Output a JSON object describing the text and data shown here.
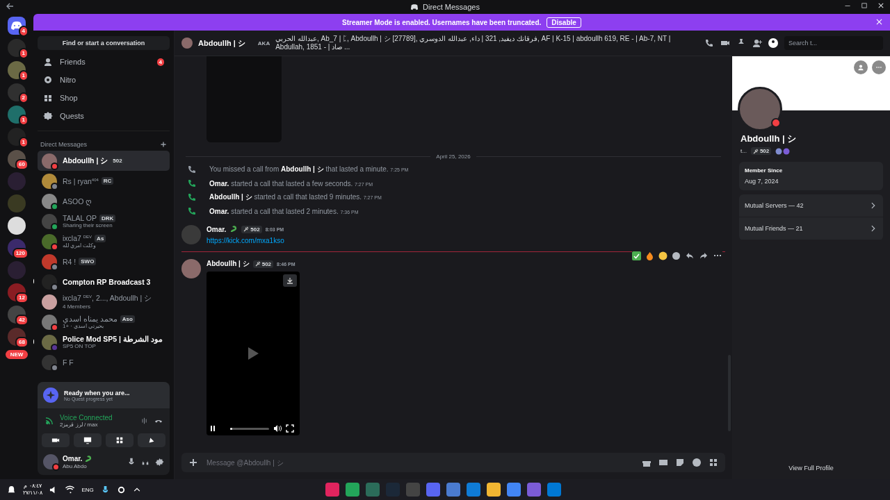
{
  "window": {
    "title": "Direct Messages"
  },
  "banner": {
    "text": "Streamer Mode is enabled. Usernames have been truncated.",
    "button": "Disable"
  },
  "servers": [
    {
      "kind": "home",
      "badge": "4",
      "color": "#5865f2"
    },
    {
      "kind": "server",
      "badge": "1",
      "color": "#2a2a2a"
    },
    {
      "kind": "server",
      "badge": "1",
      "color": "#6b6a45"
    },
    {
      "kind": "server",
      "badge": "2",
      "color": "#303030"
    },
    {
      "kind": "server",
      "badge": "1",
      "color": "#1f6f6a"
    },
    {
      "kind": "server",
      "badge": "1",
      "color": "#222222"
    },
    {
      "kind": "server",
      "badge": "60",
      "color": "#5a5048"
    },
    {
      "kind": "server",
      "color": "#2a1f33"
    },
    {
      "kind": "server",
      "color": "#3a3a22"
    },
    {
      "kind": "server",
      "color": "#dddddd"
    },
    {
      "kind": "server",
      "badge": "120",
      "color": "#3b2a6b"
    },
    {
      "kind": "server",
      "color": "#2a1f33"
    },
    {
      "kind": "server",
      "badge": "12",
      "color": "#8a1c22"
    },
    {
      "kind": "server",
      "badge": "42",
      "color": "#444444"
    },
    {
      "kind": "server",
      "badge": "68",
      "color": "#5a2a2a"
    },
    {
      "kind": "new",
      "badge": "NEW"
    }
  ],
  "sidebar": {
    "search": "Find or start a conversation",
    "nav": [
      {
        "label": "Friends",
        "badge": "4"
      },
      {
        "label": "Nitro"
      },
      {
        "label": "Shop"
      },
      {
        "label": "Quests"
      }
    ],
    "section": "Direct Messages",
    "dms": [
      {
        "name": "Abdoullh | シ",
        "tag": "502",
        "selected": true,
        "unread": false,
        "color": "#f23f43"
      },
      {
        "name": "Rs | ryan$^{404}$",
        "tag": "RC",
        "selected": false,
        "unread": false,
        "color": "#80848e"
      },
      {
        "name": "ASOO ღ",
        "selected": false,
        "unread": false,
        "color": "#23a55a"
      },
      {
        "name": "TALAL OP",
        "tag": "DRK",
        "subtitle": "Sharing their screen",
        "selected": false,
        "unread": false,
        "color": "#23a55a"
      },
      {
        "name": "ixcla7 $^{DEV}$",
        "tag": "As",
        "subtitle": "وكلت امري لله",
        "selected": false,
        "unread": false,
        "color": "#f23f43"
      },
      {
        "name": "R4 !",
        "tag": "SWO",
        "selected": false,
        "unread": false,
        "color": "#80848e"
      },
      {
        "name": "Compton RP Broadcast 3",
        "selected": false,
        "unread": true,
        "color": "#80848e"
      },
      {
        "name": "ixcla7 $^{DEV}$, 2..., Abdoullh | シ",
        "subtitle": "4 Members",
        "selected": false,
        "unread": false
      },
      {
        "name": "محمد يمناه اسدي",
        "tag": "Aso",
        "subtitle": "بحيرتي اسدي · +1",
        "selected": false,
        "unread": false,
        "color": "#f23f43"
      },
      {
        "name": "Police Mod SP5 | مود الشرطة",
        "subtitle": "SP5 ON TOP",
        "selected": false,
        "unread": true,
        "color": "#593695"
      },
      {
        "name": "F F",
        "selected": false,
        "unread": false,
        "color": "#80848e"
      }
    ]
  },
  "quest": {
    "title": "Ready when you are...",
    "subtitle": "No Quest progress yet"
  },
  "voice": {
    "status": "Voice Connected",
    "channel": "2لرز قرمز / max"
  },
  "user": {
    "name": "Omar.",
    "status": "Abu Abdo"
  },
  "header": {
    "name": "Abdoullh | シ",
    "aka": "AKA",
    "aliases": "عبدالله الحربي, Ab_7 | ᛈ, Abdoullh | シ [27789], فرقانك ديفيد, 321 | داء, عبدالله الدوسري, AF | K-15 | abdoullh 619, RE - | Ab-7, NT | Abdullah, 1851 - | صاد ...",
    "search": {
      "placeholder": "Search t..."
    }
  },
  "chat": {
    "date": "April 25, 2026",
    "calls": [
      {
        "kind": "missed",
        "before": "You missed a call from",
        "actor": "Abdoullh | シ",
        "after": "that lasted a minute.",
        "time": "7:25 PM"
      },
      {
        "kind": "call",
        "actor": "Omar.",
        "after": "started a call that lasted a few seconds.",
        "time": "7:27 PM"
      },
      {
        "kind": "call",
        "actor": "Abdoullh | シ",
        "after": "started a call that lasted 9 minutes.",
        "time": "7:27 PM"
      },
      {
        "kind": "call",
        "actor": "Omar.",
        "after": "started a call that lasted 2 minutes.",
        "time": "7:36 PM"
      }
    ],
    "messages": [
      {
        "author": "Omar.",
        "tag": "502",
        "time": "8:03 PM",
        "link": "https://kick.com/mxa1kso",
        "kind": "link"
      },
      {
        "author": "Abdoullh | シ",
        "tag": "502",
        "time": "8:46 PM",
        "kind": "video",
        "progress": {
          "level": 0.06
        }
      }
    ],
    "composer": {
      "placeholder": "Message @Abdoullh | シ"
    }
  },
  "profile": {
    "name": "Abdoullh | シ",
    "handle": "t...",
    "tag": "502",
    "member_since_label": "Member Since",
    "member_since": "Aug 7, 2024",
    "rows": [
      "Mutual Servers — 42",
      "Mutual Friends — 21"
    ],
    "button": "View Full Profile"
  },
  "taskbar": {
    "time": "٠٨:٤٧ م",
    "date": "٢٧/١١/٠٨",
    "lang": "ENG"
  }
}
